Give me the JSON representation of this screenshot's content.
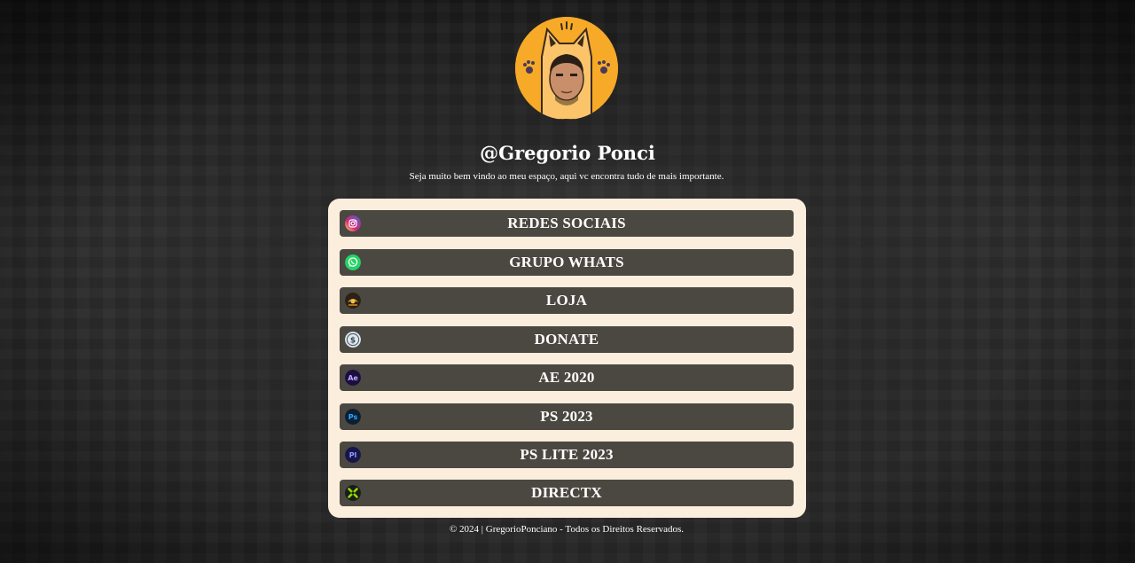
{
  "profile": {
    "username": "@Gregorio Ponci",
    "tagline": "Seja muito bem vindo ao meu espaço, aqui vc encontra tudo de mais importante."
  },
  "links": [
    {
      "label": "REDES SOCIAIS",
      "icon": "instagram-icon"
    },
    {
      "label": "GRUPO WHATS",
      "icon": "whatsapp-icon"
    },
    {
      "label": "LOJA",
      "icon": "store-icon"
    },
    {
      "label": "DONATE",
      "icon": "dollar-coin-icon"
    },
    {
      "label": "AE 2020",
      "icon": "after-effects-icon",
      "icon_text": "Ae"
    },
    {
      "label": "PS 2023",
      "icon": "photoshop-icon",
      "icon_text": "Ps"
    },
    {
      "label": "PS LITE 2023",
      "icon": "prelude-icon",
      "icon_text": "Pl"
    },
    {
      "label": "DIRECTX",
      "icon": "directx-icon"
    }
  ],
  "footer": "© 2024 | GregorioPonciano - Todos os Direitos Reservados.",
  "colors": {
    "card_bg": "#fbeedd",
    "button_bg": "#4b4741",
    "avatar_bg": "#f7a928"
  }
}
